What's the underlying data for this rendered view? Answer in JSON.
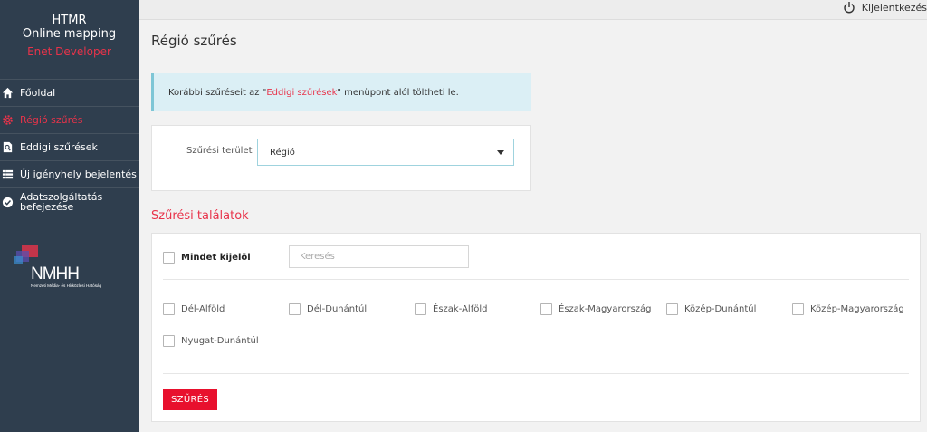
{
  "brand": {
    "line1": "HTMR",
    "line2": "Online mapping",
    "line3": "Enet Developer"
  },
  "logo": {
    "text": "NMHH",
    "subtitle": "Nemzeti Média- és Hírközlési Hatóság"
  },
  "nav": [
    {
      "label": "Főoldal",
      "icon": "home-icon",
      "active": false
    },
    {
      "label": "Régió szűrés",
      "icon": "gear-icon",
      "active": true
    },
    {
      "label": "Eddigi szűrések",
      "icon": "search-document-icon",
      "active": false
    },
    {
      "label": "Új igényhely bejelentés",
      "icon": "list-icon",
      "active": false
    },
    {
      "label": "Adatszolgáltatás befejezése",
      "icon": "check-circle-icon",
      "active": false
    }
  ],
  "topbar": {
    "logout_label": "Kijelentkezés",
    "logout_icon": "power-icon"
  },
  "page": {
    "title": "Régió szűrés"
  },
  "alert": {
    "before": "Korábbi szűréseit az \"",
    "link": "Eddigi szűrések",
    "after": "\" menüpont alól töltheti le."
  },
  "filter": {
    "label": "Szűrési terület",
    "selected": "Régió"
  },
  "results": {
    "title": "Szűrési találatok",
    "select_all": "Mindet kijelöl",
    "search_placeholder": "Keresés",
    "regions": [
      "Dél-Alföld",
      "Dél-Dunántúl",
      "Észak-Alföld",
      "Észak-Magyarország",
      "Közép-Dunántúl",
      "Közép-Magyarország",
      "Nyugat-Dunántúl"
    ],
    "button_label": "SZŰRÉS"
  },
  "colors": {
    "sidebar": "#2f3e4e",
    "accent": "#e8334a",
    "button": "#e8102d",
    "alert_bg": "#dbeff5"
  }
}
